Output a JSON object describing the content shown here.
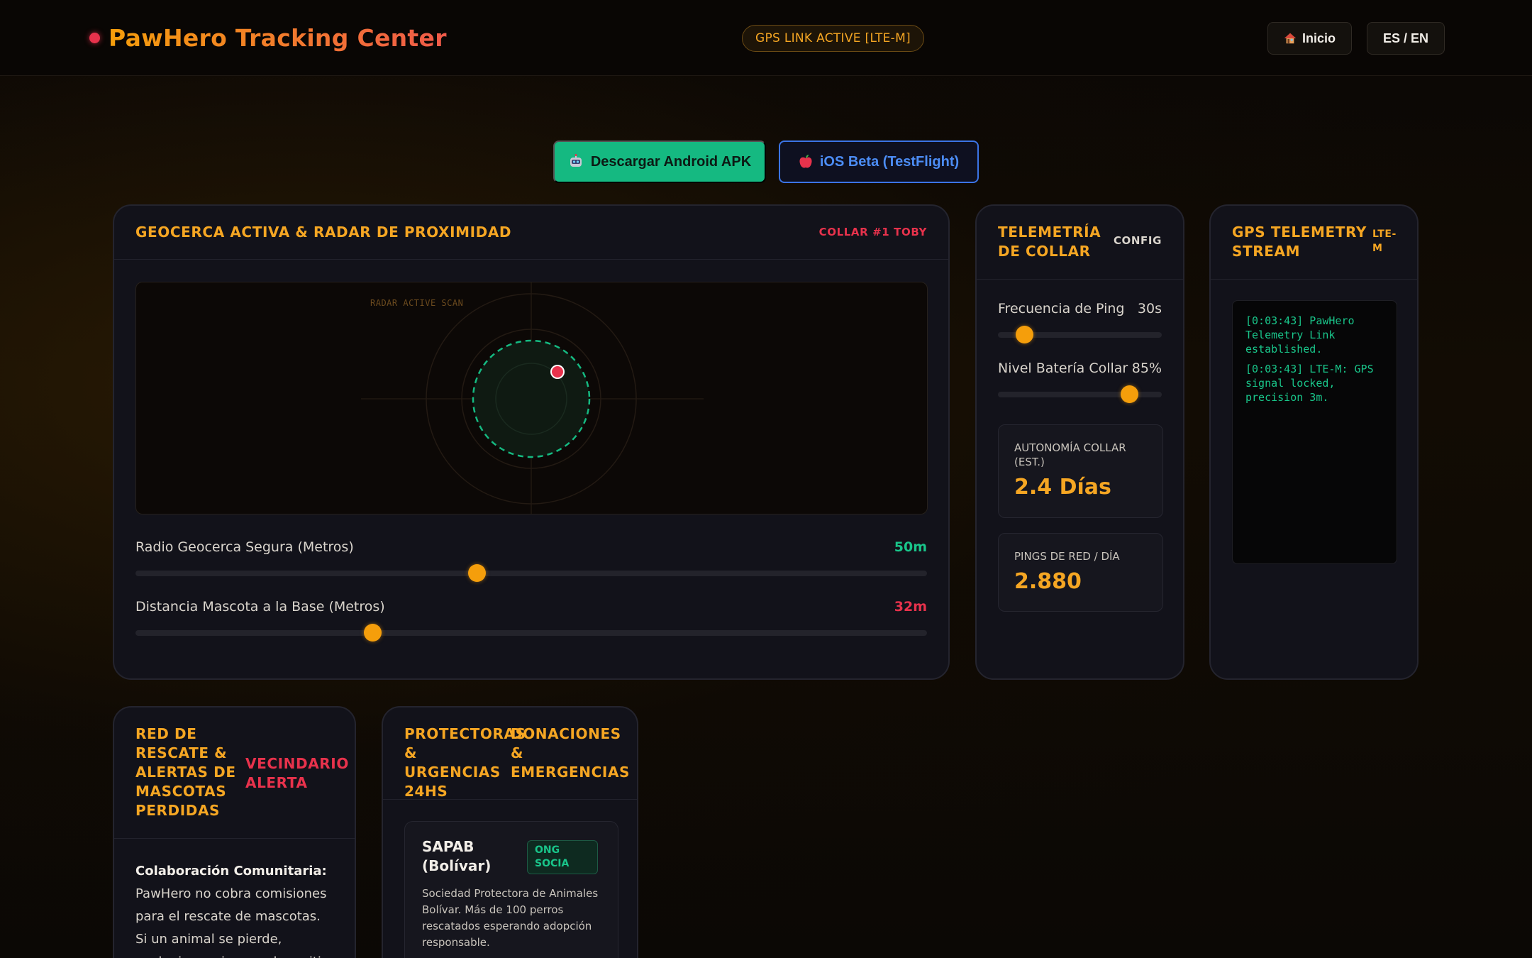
{
  "header": {
    "title": "PawHero Tracking Center",
    "gps_status": "GPS LINK ACTIVE [LTE-M]",
    "home_label": "Inicio",
    "lang_label": "ES / EN"
  },
  "downloads": {
    "android_label": "Descargar Android APK",
    "ios_label": "iOS Beta (TestFlight)"
  },
  "geofence": {
    "title": "Geocerca activa & radar de proximidad",
    "tag": "COLLAR #1 TOBY",
    "radar_label": "RADAR ACTIVE SCAN",
    "radius": {
      "label": "Radio Geocerca Segura (Metros)",
      "value_text": "50m",
      "fraction": 0.43
    },
    "distance": {
      "label": "Distancia Mascota a la Base (Metros)",
      "value_text": "32m",
      "fraction": 0.295
    }
  },
  "telemetry": {
    "title": "Telemetría de collar",
    "tag": "CONFIG",
    "ping": {
      "label": "Frecuencia de Ping",
      "value_text": "30s",
      "fraction": 0.12
    },
    "battery": {
      "label": "Nivel Batería Collar",
      "value_text": "85%",
      "fraction": 0.84
    },
    "autonomy": {
      "label": "AUTONOMÍA COLLAR (EST.)",
      "value": "2.4 Días"
    },
    "pings": {
      "label": "PINGS DE RED / DÍA",
      "value": "2.880"
    }
  },
  "gps_stream": {
    "title": "GPS Telemetry Stream",
    "tag": "LTE-M",
    "lines": [
      "[0:03:43] PawHero Telemetry Link established.",
      "[0:03:43] LTE-M: GPS signal locked, precision 3m."
    ]
  },
  "rescue": {
    "title": "Red de rescate & alertas de mascotas perdidas",
    "tag": "VECINDARIO ALERTA",
    "body_strong": "Colaboración Comunitaria:",
    "body_text": "PawHero no cobra comisiones para el rescate de mascotas. Si un animal se pierde, cualquier vecino puede emitir una alerta"
  },
  "protect": {
    "title": "Protectoras & urgencias 24hs",
    "tag": "Donaciones & emergencias",
    "org": {
      "name": "SAPAB (Bolívar)",
      "badge": "ONG SOCIA",
      "desc": "Sociedad Protectora de Animales Bolívar. Más de 100 perros rescatados esperando adopción responsable."
    }
  },
  "colors": {
    "accent": "#f5a623",
    "alert": "#e8324c",
    "success": "#19c58a",
    "ios": "#3b74e6"
  },
  "icons": {
    "android": "robot-icon",
    "ios": "apple-icon",
    "home": "house-icon",
    "status": "status-dot-icon"
  }
}
